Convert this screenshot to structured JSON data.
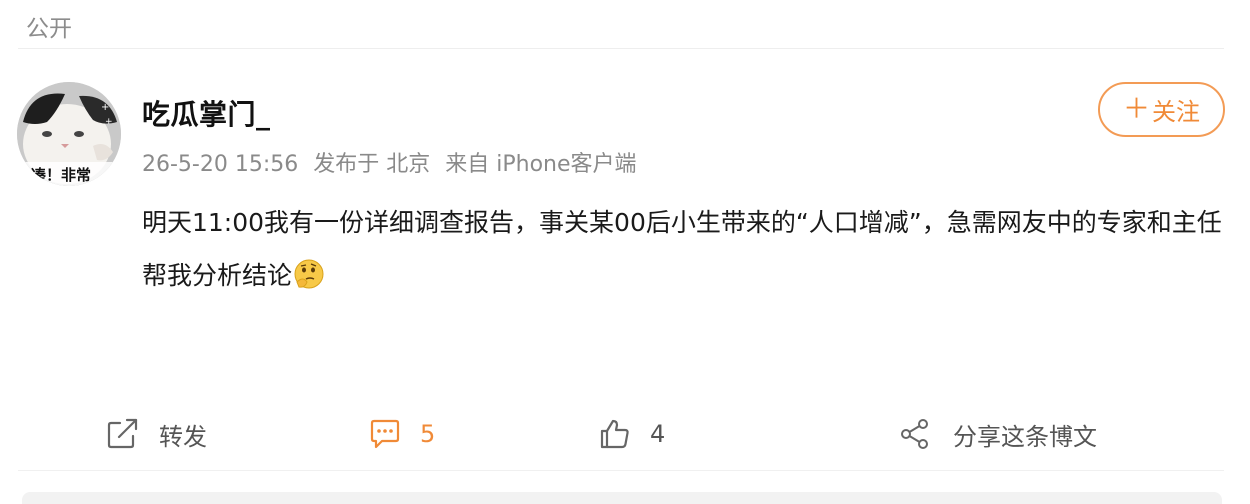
{
  "visibility": "公开",
  "author": {
    "name": "吃瓜掌门_",
    "avatar_caption": "凑！非常"
  },
  "meta": {
    "date": "26-5-20 15:56",
    "location": "发布于 北京",
    "source": "来自 iPhone客户端"
  },
  "follow_button": {
    "icon": "＋",
    "label": "关注"
  },
  "post": {
    "text": "明天11:00我有一份详细调查报告，事关某00后小生带来的“人口增减”，急需网友中的专家和主任帮我分析结论",
    "emoji": "thinking-face"
  },
  "actions": {
    "repost_label": "转发",
    "comment_count": "5",
    "like_count": "4",
    "share_label": "分享这条博文"
  },
  "colors": {
    "accent": "#f08a37",
    "muted_text": "#8a8a8a"
  }
}
